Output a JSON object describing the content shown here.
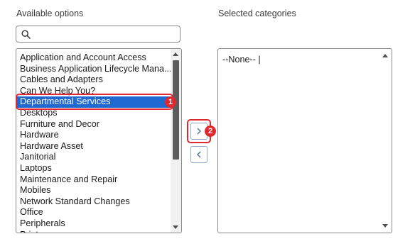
{
  "available": {
    "label": "Available options",
    "search_icon": "search-icon",
    "options": [
      "Application and Account Access",
      "Business Application Lifecycle Mana...",
      "Cables and Adapters",
      "Can We Help You?",
      "Departmental Services",
      "Desktops",
      "Furniture and Decor",
      "Hardware",
      "Hardware Asset",
      "Janitorial",
      "Laptops",
      "Maintenance and Repair",
      "Mobiles",
      "Network Standard Changes",
      "Office",
      "Peripherals",
      "Printers"
    ],
    "selected_option": "Departmental Services"
  },
  "selected": {
    "label": "Selected categories",
    "items": [
      "--None-- |"
    ]
  },
  "buttons": {
    "add_icon": "chevron-right-icon",
    "remove_icon": "chevron-left-icon"
  },
  "annotations": {
    "badge_1": "1",
    "badge_2": "2",
    "color": "#e0282e"
  },
  "colors": {
    "selection": "#1f69d1",
    "accent_border": "#8fa9c8"
  }
}
